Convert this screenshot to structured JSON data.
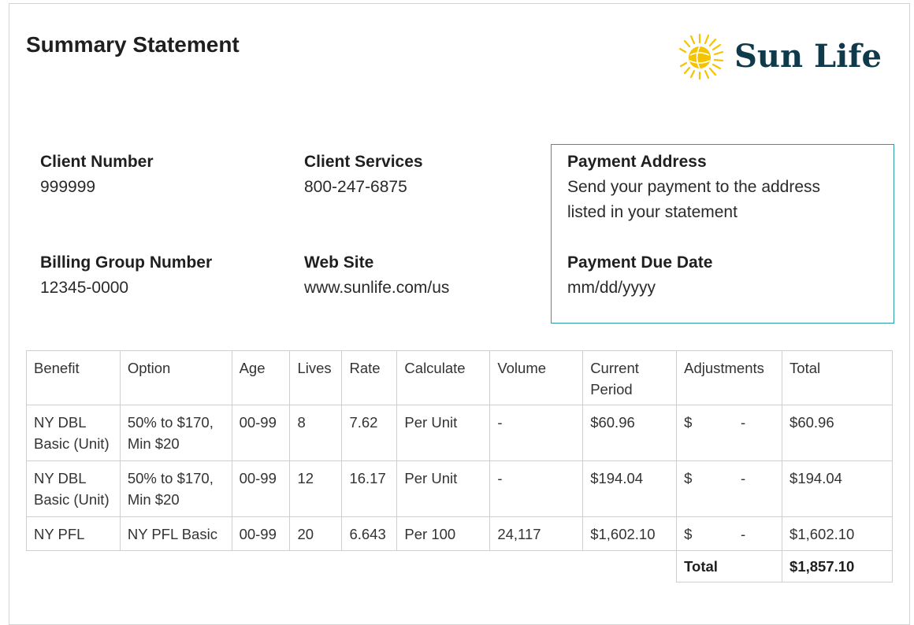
{
  "header": {
    "title": "Summary Statement",
    "brand": "Sun Life",
    "brand_color": "#0e3a4c",
    "sun_color": "#f5c400"
  },
  "info": {
    "client_number_label": "Client Number",
    "client_number": "999999",
    "billing_group_label": "Billing Group Number",
    "billing_group": "12345-0000",
    "client_services_label": "Client Services",
    "client_services": "800-247-6875",
    "web_site_label": "Web Site",
    "web_site": "www.sunlife.com/us",
    "payment_address_label": "Payment Address",
    "payment_address_line1": "Send your payment to the address",
    "payment_address_line2": "listed in your statement",
    "payment_due_label": "Payment Due Date",
    "payment_due": "mm/dd/yyyy",
    "box_border_color": "#2b9ba3"
  },
  "table": {
    "headers": [
      "Benefit",
      "Option",
      "Age",
      "Lives",
      "Rate",
      "Calculate",
      "Volume",
      "Current Period",
      "Adjustments",
      "Total"
    ],
    "current_period_line1": "Current",
    "current_period_line2": "Period",
    "rows": [
      {
        "benefit_line1": "NY DBL",
        "benefit_line2": "Basic (Unit)",
        "option_line1": "50% to $170,",
        "option_line2": "Min $20",
        "age": "00-99",
        "lives": "8",
        "rate": "7.62",
        "calculate": "Per Unit",
        "volume": "-",
        "current_period": "$60.96",
        "adj_currency": "$",
        "adj_value": "-",
        "total": "$60.96"
      },
      {
        "benefit_line1": "NY DBL",
        "benefit_line2": "Basic (Unit)",
        "option_line1": "50% to $170,",
        "option_line2": "Min $20",
        "age": "00-99",
        "lives": "12",
        "rate": "16.17",
        "calculate": "Per Unit",
        "volume": "-",
        "current_period": "$194.04",
        "adj_currency": "$",
        "adj_value": "-",
        "total": "$194.04"
      },
      {
        "benefit_line1": "NY PFL",
        "benefit_line2": "",
        "option_line1": "NY PFL Basic",
        "option_line2": "",
        "age": "00-99",
        "lives": "20",
        "rate": "6.643",
        "calculate": "Per 100",
        "volume": "24,117",
        "current_period": "$1,602.10",
        "adj_currency": "$",
        "adj_value": "-",
        "total": "$1,602.10"
      }
    ],
    "total_label": "Total",
    "grand_total": "$1,857.10"
  }
}
